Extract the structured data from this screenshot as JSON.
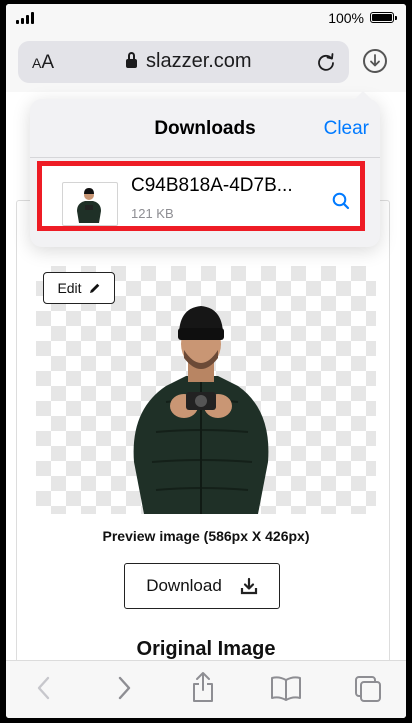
{
  "status": {
    "battery": "100%"
  },
  "address_bar": {
    "text_size_small": "A",
    "text_size_large": "A",
    "domain": "slazzer.com"
  },
  "downloads": {
    "title": "Downloads",
    "clear_label": "Clear",
    "items": [
      {
        "filename": "C94B818A-4D7B...",
        "size": "121 KB"
      }
    ]
  },
  "page": {
    "edit_label": "Edit",
    "preview_caption": "Preview image (586px X 426px)",
    "download_label": "Download",
    "original_heading": "Original Image"
  },
  "icons": {
    "signal": "signal-bars-icon",
    "battery": "battery-icon",
    "lock": "lock-icon",
    "reload": "reload-icon",
    "download": "download-arrow-icon",
    "magnify": "magnifying-glass-icon",
    "pencil": "pencil-icon",
    "back": "chevron-left-icon",
    "forward": "chevron-right-icon",
    "share": "share-icon",
    "bookmarks": "book-icon",
    "tabs": "tabs-icon"
  },
  "colors": {
    "accent": "#007aff",
    "highlight": "#ee1c25"
  }
}
